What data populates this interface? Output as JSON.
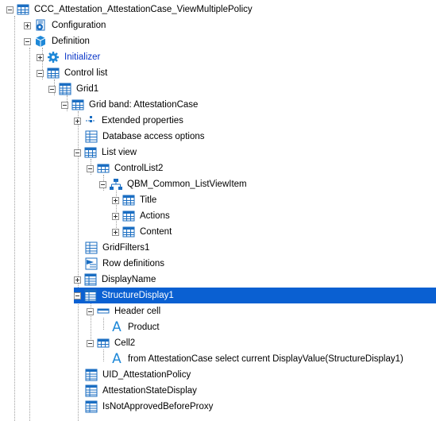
{
  "tree": {
    "root": "CCC_Attestation_AttestationCase_ViewMultiplePolicy",
    "configuration": "Configuration",
    "definition": "Definition",
    "initializer": "Initializer",
    "control_list": "Control list",
    "grid1": "Grid1",
    "grid_band": "Grid band: AttestationCase",
    "extended_properties": "Extended properties",
    "database_access_options": "Database access options",
    "list_view": "List view",
    "control_list2": "ControlList2",
    "list_view_item": "QBM_Common_ListViewItem",
    "title": "Title",
    "actions": "Actions",
    "content": "Content",
    "grid_filters": "GridFilters1",
    "row_definitions": "Row definitions",
    "display_name": "DisplayName",
    "structure_display": "StructureDisplay1",
    "header_cell": "Header cell",
    "product": "Product",
    "cell2": "Cell2",
    "cell2_expr": "from AttestationCase select current DisplayValue(StructureDisplay1)",
    "uid_policy": "UID_AttestationPolicy",
    "state_display": "AttestationStateDisplay",
    "is_not_approved": "IsNotApprovedBeforeProxy"
  }
}
